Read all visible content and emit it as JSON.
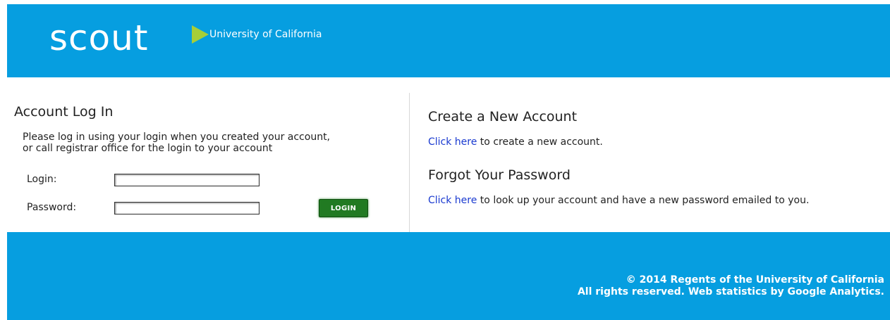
{
  "header": {
    "logo_text": "scout",
    "logo_subtitle": "University of California",
    "colors": {
      "banner": "#069ee0",
      "arrow": "#a6ce39"
    }
  },
  "login": {
    "title": "Account Log In",
    "intro_line1": "Please log in using your login when you created your account,",
    "intro_line2": "or call registrar office for the login to your account",
    "login_label": "Login:",
    "login_value": "",
    "password_label": "Password:",
    "password_value": "",
    "button_label": "LOGIN"
  },
  "create_account": {
    "title": "Create a New Account",
    "link_text": "Click here",
    "text": " to create a new account."
  },
  "forgot_password": {
    "title": "Forgot Your Password",
    "link_text": "Click here",
    "text": " to look up your account and have a new password emailed to you."
  },
  "footer": {
    "copyright": "© 2014 Regents of the University of California",
    "rights": "All rights reserved. Web statistics by Google Analytics."
  }
}
